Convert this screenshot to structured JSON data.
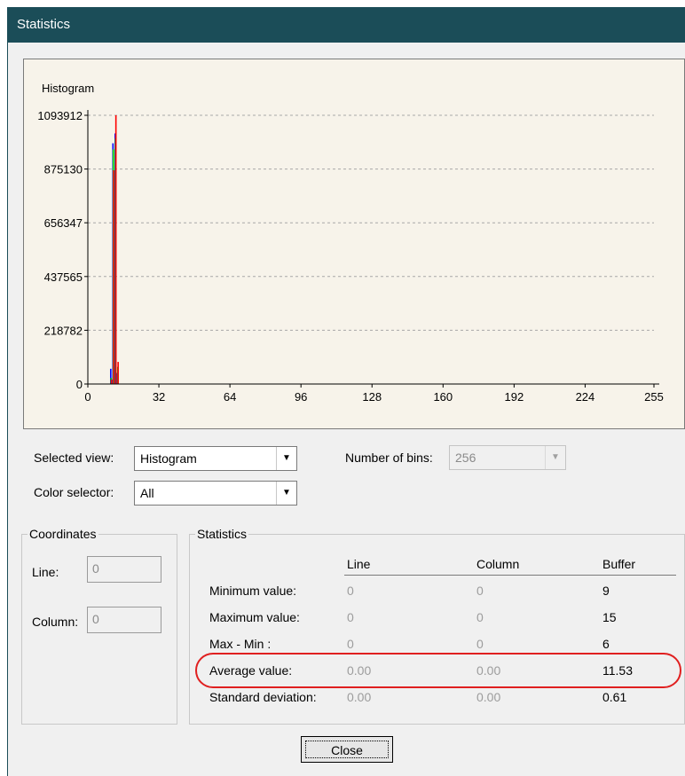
{
  "window": {
    "title": "Statistics"
  },
  "chart_data": {
    "type": "bar",
    "title": "Histogram",
    "xlim": [
      0,
      255
    ],
    "ylim": [
      0,
      1093912
    ],
    "x_ticks": [
      "0",
      "32",
      "64",
      "96",
      "128",
      "160",
      "192",
      "224",
      "255"
    ],
    "y_ticks": [
      "0",
      "218782",
      "437565",
      "656347",
      "875130",
      "1093912"
    ],
    "grid": "horizontal-dashed",
    "series": [
      {
        "color": "#0000ff",
        "points": [
          {
            "x": 10,
            "y": 62000
          },
          {
            "x": 11,
            "y": 980000
          },
          {
            "x": 12,
            "y": 1020000
          },
          {
            "x": 13,
            "y": 45000
          }
        ]
      },
      {
        "color": "#00d000",
        "points": [
          {
            "x": 10,
            "y": 25000
          },
          {
            "x": 11,
            "y": 955000
          },
          {
            "x": 12,
            "y": 1000000
          },
          {
            "x": 13,
            "y": 70000
          }
        ]
      },
      {
        "color": "#ff0000",
        "points": [
          {
            "x": 10,
            "y": 18000
          },
          {
            "x": 11,
            "y": 870000
          },
          {
            "x": 12,
            "y": 1093912
          },
          {
            "x": 13,
            "y": 90000
          }
        ]
      }
    ]
  },
  "controls": {
    "selected_view_label": "Selected view:",
    "selected_view_value": "Histogram",
    "color_selector_label": "Color selector:",
    "color_selector_value": "All",
    "bins_label": "Number of bins:",
    "bins_value": "256",
    "dropdown_arrow": "▼"
  },
  "coordinates": {
    "title": "Coordinates",
    "line_label": "Line:",
    "line_value": "0",
    "column_label": "Column:",
    "column_value": "0"
  },
  "statistics": {
    "title": "Statistics",
    "headers": [
      "Line",
      "Column",
      "Buffer"
    ],
    "rows": [
      {
        "label": "Minimum value:",
        "line": "0",
        "column": "0",
        "buffer": "9"
      },
      {
        "label": "Maximum value:",
        "line": "0",
        "column": "0",
        "buffer": "15"
      },
      {
        "label": "Max - Min :",
        "line": "0",
        "column": "0",
        "buffer": "6"
      },
      {
        "label": "Average value:",
        "line": "0.00",
        "column": "0.00",
        "buffer": "11.53"
      },
      {
        "label": "Standard deviation:",
        "line": "0.00",
        "column": "0.00",
        "buffer": "0.61"
      }
    ]
  },
  "buttons": {
    "close_label": "Close"
  },
  "colors": {
    "titlebar": "#1b4d58",
    "chart_bg": "#f7f3ea",
    "highlight": "#e02020"
  }
}
